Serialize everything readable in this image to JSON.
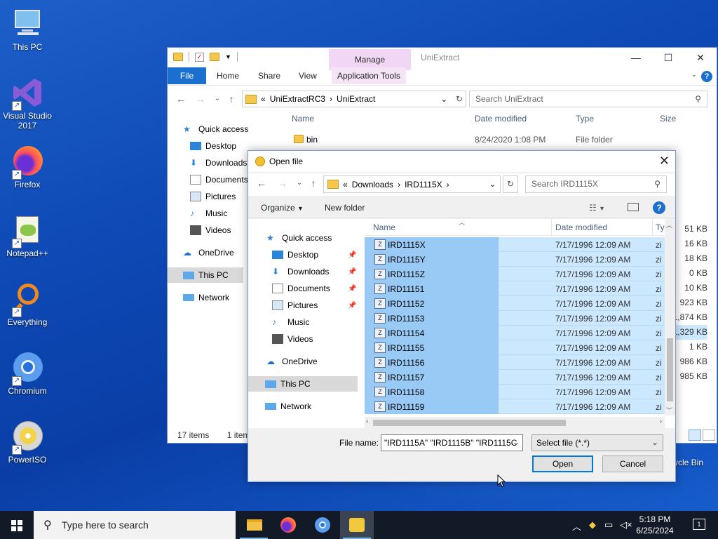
{
  "desktop": {
    "icons": [
      {
        "label": "This PC",
        "icon": "computer-icon"
      },
      {
        "label": "Visual Studio 2017",
        "icon": "visual-studio-icon"
      },
      {
        "label": "Firefox",
        "icon": "firefox-icon"
      },
      {
        "label": "Notepad++",
        "icon": "notepadpp-icon"
      },
      {
        "label": "Everything",
        "icon": "everything-icon"
      },
      {
        "label": "Chromium",
        "icon": "chromium-icon"
      },
      {
        "label": "PowerISO",
        "icon": "poweriso-icon"
      }
    ],
    "recycle_bin": "cycle Bin"
  },
  "explorer": {
    "context_tab": "Manage",
    "app_title": "UniExtract",
    "ribbon_tabs": {
      "file": "File",
      "home": "Home",
      "share": "Share",
      "view": "View",
      "app_tools": "Application Tools"
    },
    "address": {
      "prefix": "«",
      "part1": "UniExtractRC3",
      "sep": "›",
      "part2": "UniExtract"
    },
    "search_placeholder": "Search UniExtract",
    "columns": {
      "name": "Name",
      "date": "Date modified",
      "type": "Type",
      "size": "Size"
    },
    "first_row": {
      "name": "bin",
      "date": "8/24/2020 1:08 PM",
      "type": "File folder"
    },
    "nav": [
      {
        "label": "Quick access"
      },
      {
        "label": "Desktop"
      },
      {
        "label": "Downloads"
      },
      {
        "label": "Documents"
      },
      {
        "label": "Pictures"
      },
      {
        "label": "Music"
      },
      {
        "label": "Videos"
      },
      {
        "label": "OneDrive"
      },
      {
        "label": "This PC"
      },
      {
        "label": "Network"
      }
    ],
    "sizes": [
      "51 KB",
      "16 KB",
      "18 KB",
      "0 KB",
      "10 KB",
      "923 KB",
      "1,874 KB",
      "1,329 KB",
      "1 KB",
      "986 KB",
      "985 KB"
    ],
    "status": {
      "items": "17 items",
      "selected": "1 item"
    }
  },
  "dialog": {
    "title": "Open file",
    "address": {
      "prefix": "«",
      "part1": "Downloads",
      "sep": "›",
      "part2": "IRD1115X",
      "sep2": "›"
    },
    "search_placeholder": "Search IRD1115X",
    "toolbar": {
      "organize": "Organize",
      "new_folder": "New folder"
    },
    "columns": {
      "name": "Name",
      "date": "Date modified",
      "type": "Ty"
    },
    "nav": [
      {
        "label": "Quick access"
      },
      {
        "label": "Desktop"
      },
      {
        "label": "Downloads"
      },
      {
        "label": "Documents"
      },
      {
        "label": "Pictures"
      },
      {
        "label": "Music"
      },
      {
        "label": "Videos"
      },
      {
        "label": "OneDrive"
      },
      {
        "label": "This PC"
      },
      {
        "label": "Network"
      }
    ],
    "files": [
      {
        "name": "IRD1115X",
        "date": "7/17/1996 12:09 AM",
        "type": "zi"
      },
      {
        "name": "IRD1115Y",
        "date": "7/17/1996 12:09 AM",
        "type": "zi"
      },
      {
        "name": "IRD1115Z",
        "date": "7/17/1996 12:09 AM",
        "type": "zi"
      },
      {
        "name": "IRD11151",
        "date": "7/17/1996 12:09 AM",
        "type": "zi"
      },
      {
        "name": "IRD11152",
        "date": "7/17/1996 12:09 AM",
        "type": "zi"
      },
      {
        "name": "IRD11153",
        "date": "7/17/1996 12:09 AM",
        "type": "zi"
      },
      {
        "name": "IRD11154",
        "date": "7/17/1996 12:09 AM",
        "type": "zi"
      },
      {
        "name": "IRD11155",
        "date": "7/17/1996 12:09 AM",
        "type": "zi"
      },
      {
        "name": "IRD11156",
        "date": "7/17/1996 12:09 AM",
        "type": "zi"
      },
      {
        "name": "IRD11157",
        "date": "7/17/1996 12:09 AM",
        "type": "zi"
      },
      {
        "name": "IRD11158",
        "date": "7/17/1996 12:09 AM",
        "type": "zi"
      },
      {
        "name": "IRD11159",
        "date": "7/17/1996 12:09 AM",
        "type": "zi"
      }
    ],
    "file_name_label": "File name:",
    "file_name_value": "\"IRD1115A\" \"IRD1115B\" \"IRD1115C",
    "file_type": "Select file (*.*)",
    "open_label": "Open",
    "cancel_label": "Cancel"
  },
  "taskbar": {
    "search_placeholder": "Type here to search",
    "time": "5:18 PM",
    "date": "6/25/2024",
    "notification_count": "1"
  }
}
